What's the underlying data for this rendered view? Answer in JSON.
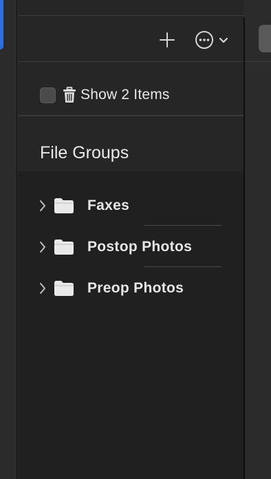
{
  "toolbar": {
    "add_icon": "plus-icon",
    "more_icon": "ellipsis-circle-icon",
    "menu_icon": "chevron-down-icon"
  },
  "trash_toggle": {
    "checked": false,
    "icon": "trash-icon",
    "label": "Show 2 Items"
  },
  "file_groups": {
    "title": "File Groups",
    "items": [
      {
        "label": "Faxes",
        "icon": "folder-icon",
        "expanded": false
      },
      {
        "label": "Postop Photos",
        "icon": "folder-icon",
        "expanded": false
      },
      {
        "label": "Preop Photos",
        "icon": "folder-icon",
        "expanded": false
      }
    ]
  },
  "colors": {
    "accent": "#2f6fe0",
    "panel_bg": "#262626",
    "list_bg": "#202020",
    "text": "#e6e6e6"
  }
}
